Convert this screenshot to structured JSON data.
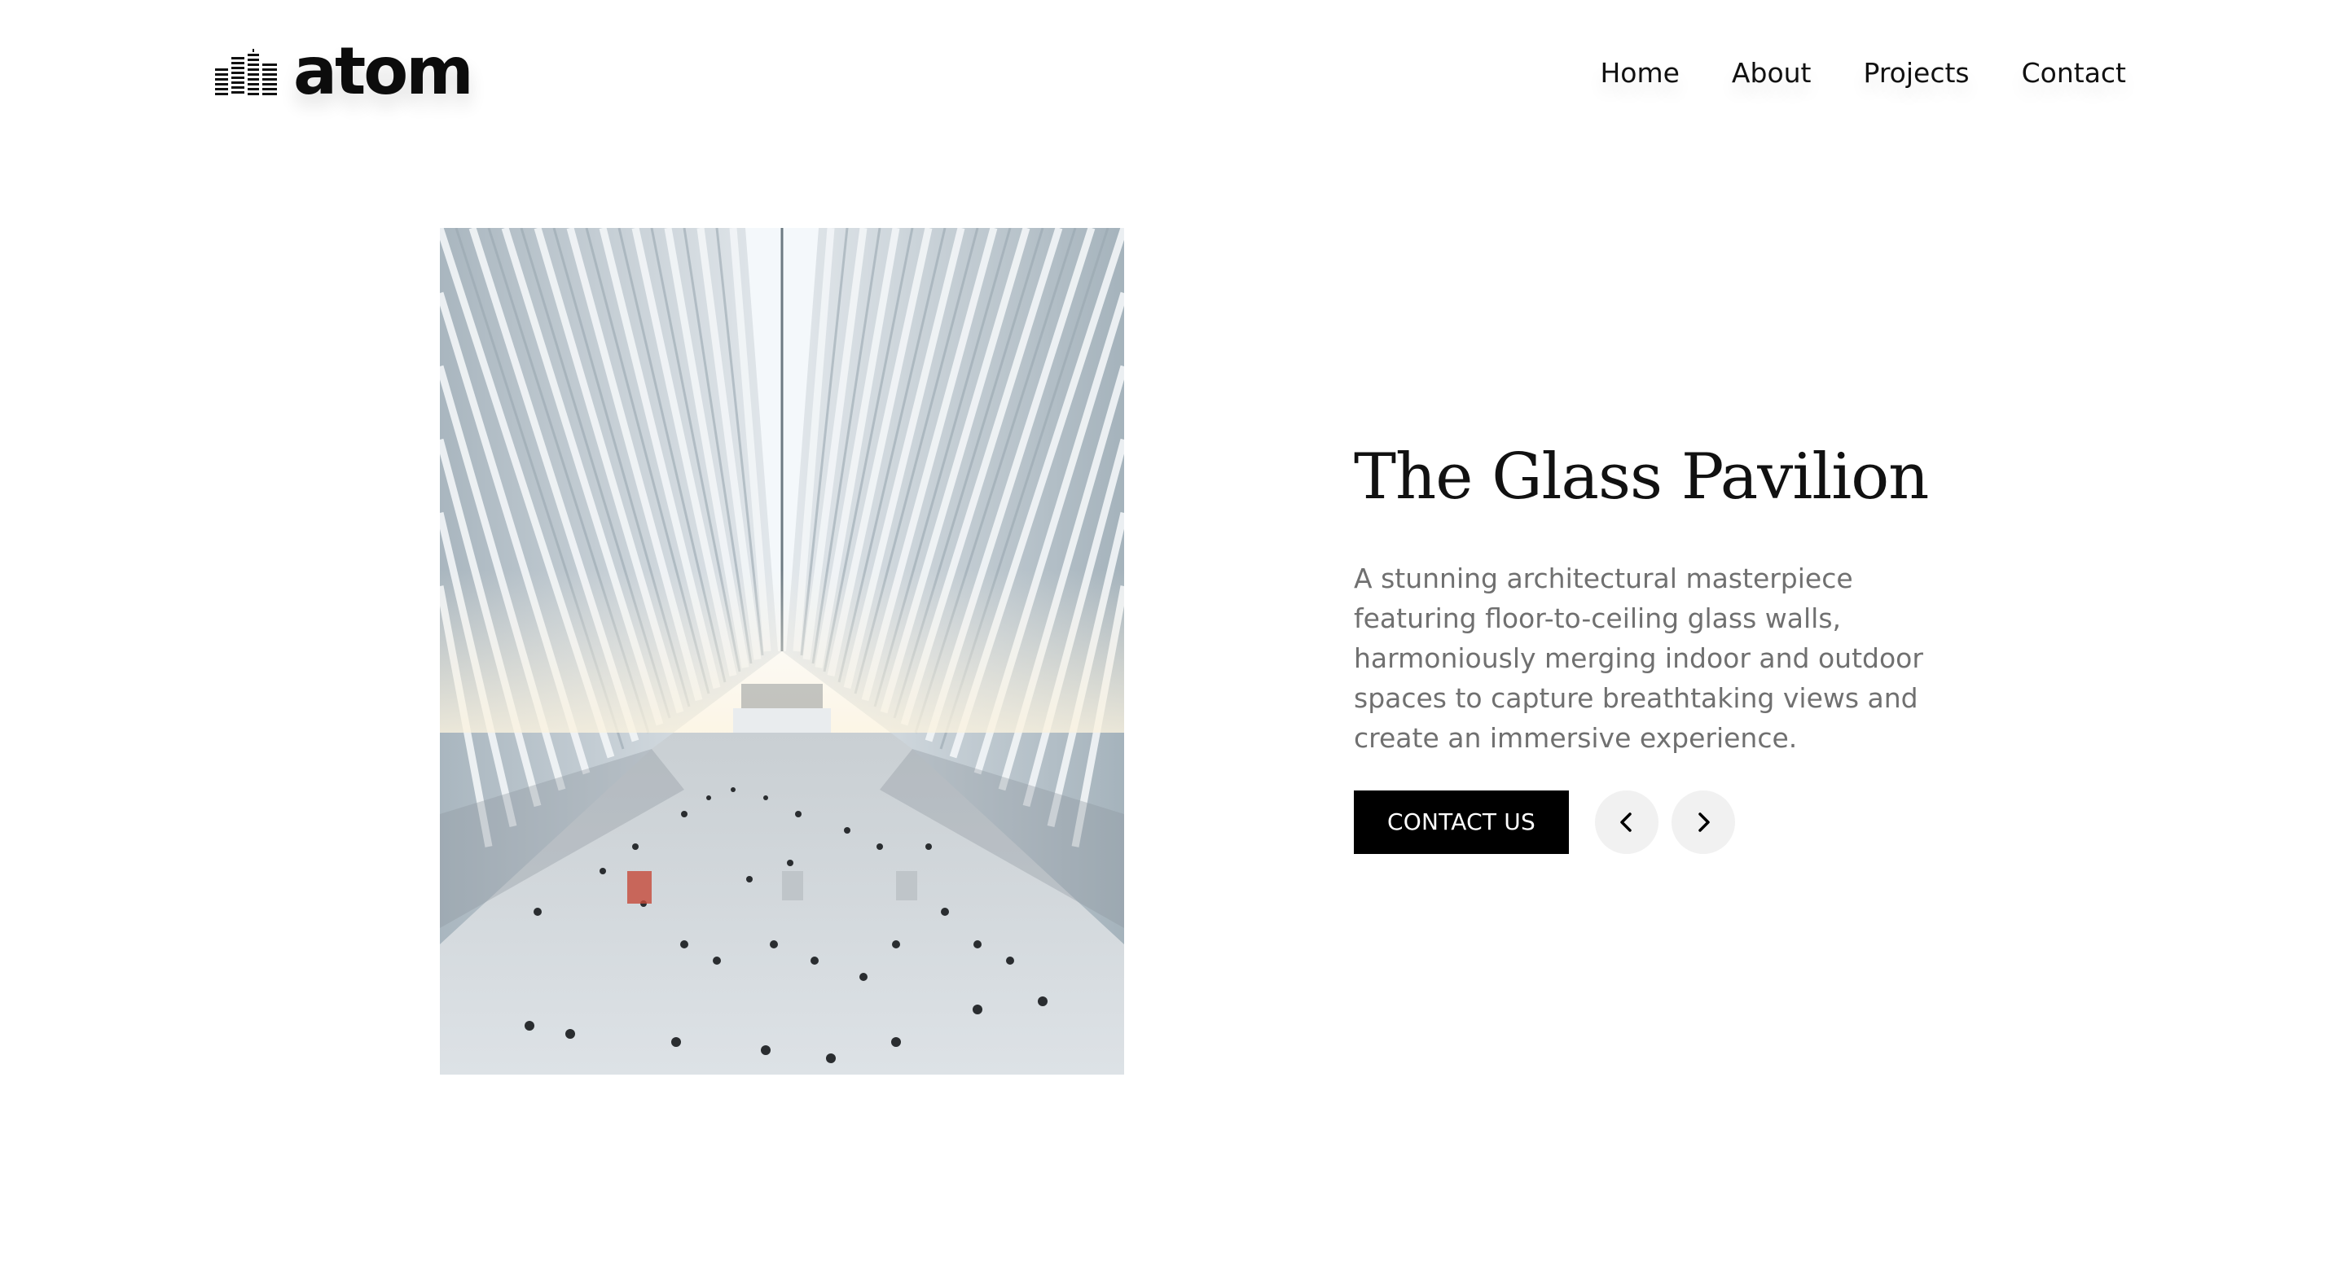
{
  "brand": {
    "name": "atom",
    "logo_icon": "buildings-icon"
  },
  "nav": {
    "items": [
      {
        "label": "Home"
      },
      {
        "label": "About"
      },
      {
        "label": "Projects"
      },
      {
        "label": "Contact"
      }
    ]
  },
  "project": {
    "title": "The Glass Pavilion",
    "description": "A stunning architectural masterpiece featuring floor-to-ceiling glass walls, harmoniously merging indoor and outdoor spaces to capture breathtaking views and create an immersive experience.",
    "image_subject": "white ribbed atrium interior with skylight and people walking"
  },
  "actions": {
    "contact_label": "CONTACT US",
    "prev_icon": "chevron-left-icon",
    "next_icon": "chevron-right-icon"
  },
  "colors": {
    "background": "#ffffff",
    "text": "#111111",
    "description_text": "#707070",
    "button_bg": "#000000",
    "button_text": "#ffffff",
    "circle_button_bg": "#f1f1f1"
  }
}
